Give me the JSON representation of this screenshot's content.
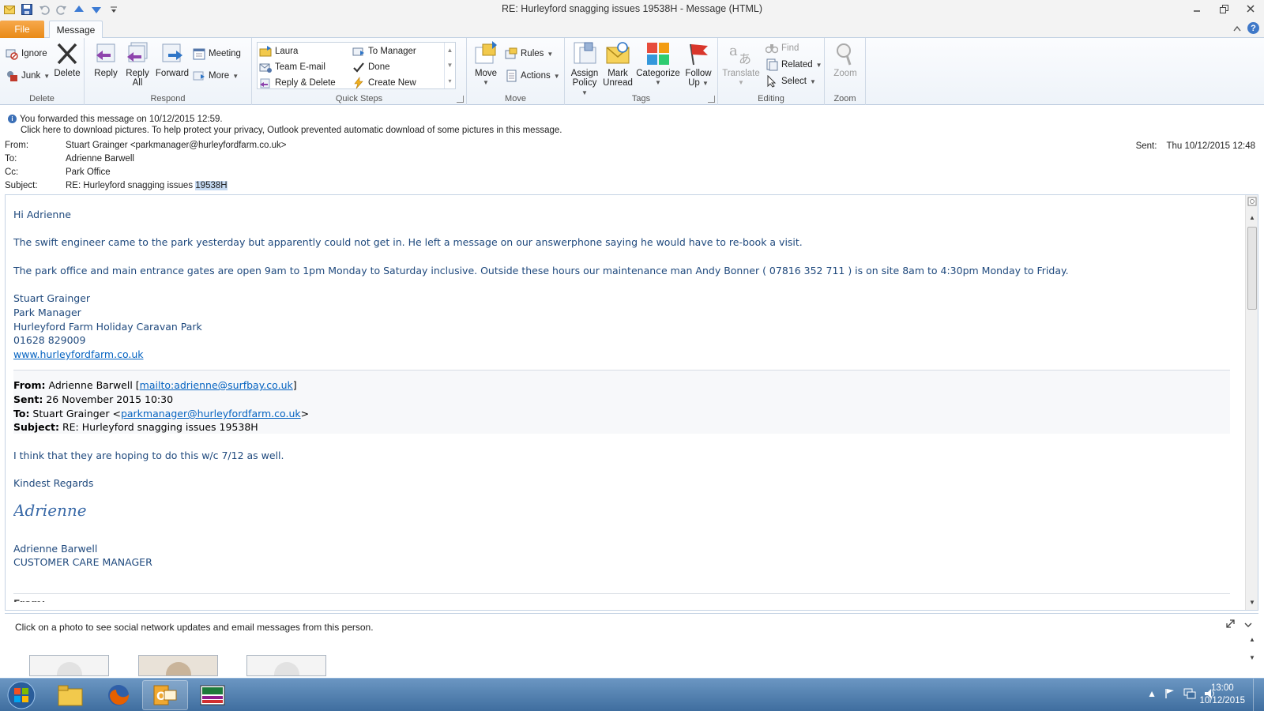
{
  "window": {
    "title": "RE: Hurleyford snagging issues 19538H  -  Message (HTML)"
  },
  "tabs": {
    "file": "File",
    "message": "Message"
  },
  "ribbon": {
    "delete_group": {
      "label": "Delete",
      "ignore": "Ignore",
      "junk": "Junk",
      "delete": "Delete"
    },
    "respond_group": {
      "label": "Respond",
      "reply": "Reply",
      "reply_all_1": "Reply",
      "reply_all_2": "All",
      "forward": "Forward",
      "meeting": "Meeting",
      "more": "More"
    },
    "quick_steps": {
      "label": "Quick Steps",
      "items": [
        "Laura",
        "Team E-mail",
        "Reply & Delete",
        "To Manager",
        "Done",
        "Create New"
      ]
    },
    "move_group": {
      "label": "Move",
      "move": "Move",
      "rules": "Rules",
      "actions": "Actions"
    },
    "tags_group": {
      "label": "Tags",
      "assign_1": "Assign",
      "assign_2": "Policy",
      "mark_1": "Mark",
      "mark_2": "Unread",
      "categorize": "Categorize",
      "follow_1": "Follow",
      "follow_2": "Up"
    },
    "editing_group": {
      "label": "Editing",
      "translate": "Translate",
      "find": "Find",
      "related": "Related",
      "select": "Select"
    },
    "zoom_group": {
      "label": "Zoom",
      "zoom": "Zoom"
    }
  },
  "info": {
    "forwarded": "You forwarded this message on 10/12/2015 12:59.",
    "pictures": "Click here to download pictures. To help protect your privacy, Outlook prevented automatic download of some pictures in this message."
  },
  "header": {
    "from_label": "From:",
    "from": "Stuart Grainger <parkmanager@hurleyfordfarm.co.uk>",
    "to_label": "To:",
    "to": "Adrienne Barwell",
    "cc_label": "Cc:",
    "cc": "Park Office",
    "subject_label": "Subject:",
    "subject_prefix": "RE: Hurleyford snagging issues ",
    "subject_highlight": "19538H",
    "sent_label": "Sent:",
    "sent": "Thu 10/12/2015 12:48"
  },
  "body": {
    "greeting": "Hi Adrienne",
    "para1": "The swift engineer came to the park yesterday but apparently could not get in. He left a message on our answerphone saying he would have to re-book a visit.",
    "para2": "The park office and main entrance gates are open 9am to 1pm Monday to Saturday inclusive. Outside these hours our maintenance man Andy Bonner ( 07816 352 711 ) is on site 8am to 4:30pm Monday to Friday.",
    "sig_name": "Stuart Grainger",
    "sig_title": "Park Manager",
    "sig_company": "Hurleyford Farm Holiday Caravan Park",
    "sig_phone": "01628 829009",
    "sig_web": "www.hurleyfordfarm.co.uk",
    "q_from_label": "From:",
    "q_from_name": " Adrienne Barwell [",
    "q_from_link": "mailto:adrienne@surfbay.co.uk",
    "q_from_end": "]",
    "q_sent_label": "Sent:",
    "q_sent": " 26 November 2015 10:30",
    "q_to_label": "To:",
    "q_to_name": " Stuart Grainger <",
    "q_to_link": "parkmanager@hurleyfordfarm.co.uk",
    "q_to_end": ">",
    "q_subject_label": "Subject:",
    "q_subject": " RE: Hurleyford snagging issues 19538H",
    "q_para": "I think that they are hoping to do this w/c 7/12 as well.",
    "q_regards": "Kindest Regards",
    "q_script": "Adrienne",
    "q_sig_name": "Adrienne Barwell",
    "q_sig_title": "CUSTOMER CARE MANAGER"
  },
  "people_pane": {
    "text": "Click on a photo to see social network updates and email messages from this person."
  },
  "taskbar": {
    "time": "13:00",
    "date": "10/12/2015"
  },
  "colors": {
    "body_text": "#1f497d",
    "link": "#0563c1",
    "file_tab": "#e98a17",
    "taskbar": "#3f6e9f"
  }
}
